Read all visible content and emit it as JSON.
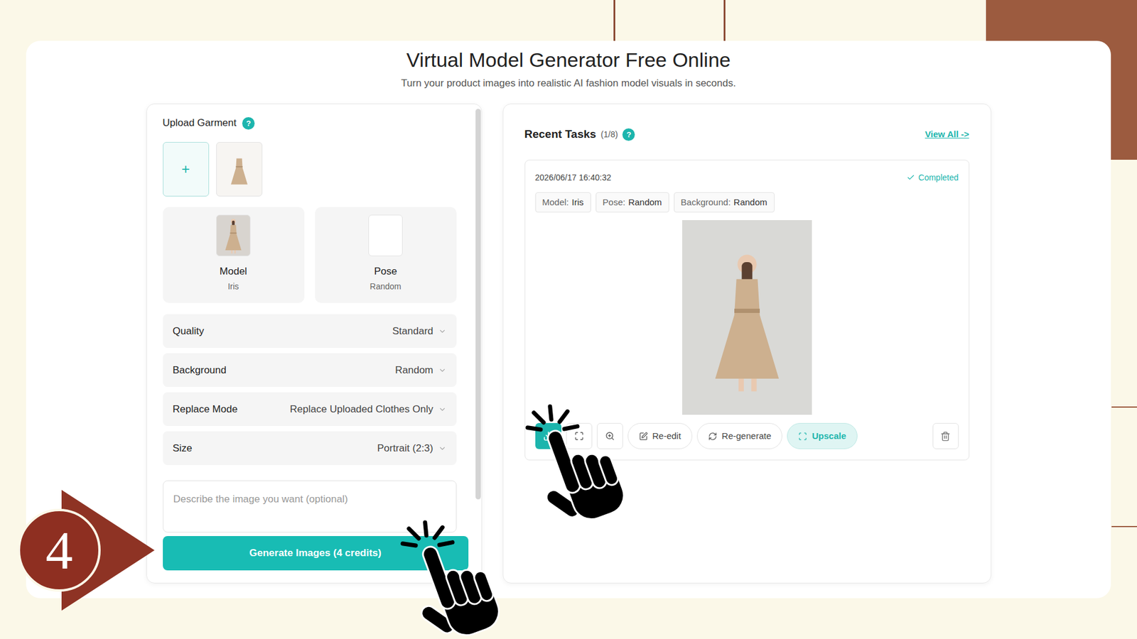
{
  "page": {
    "title": "Virtual Model Generator Free Online",
    "subtitle": "Turn your product images into realistic AI fashion model visuals in seconds."
  },
  "step": "4",
  "upload": {
    "label": "Upload Garment",
    "help": "?",
    "add": "+"
  },
  "picker_cards": [
    {
      "label": "Model",
      "value": "Iris"
    },
    {
      "label": "Pose",
      "value": "Random"
    }
  ],
  "settings": [
    {
      "label": "Quality",
      "value": "Standard"
    },
    {
      "label": "Background",
      "value": "Random"
    },
    {
      "label": "Replace Mode",
      "value": "Replace Uploaded Clothes Only"
    },
    {
      "label": "Size",
      "value": "Portrait (2:3)"
    }
  ],
  "prompt": {
    "placeholder": "Describe the image you want (optional)"
  },
  "generate_button": "Generate Images (4 credits)",
  "recent": {
    "title": "Recent Tasks",
    "count": "(1/8)",
    "help": "?",
    "view_all": "View All ->"
  },
  "task": {
    "date": "2026/06/17 16:40:32",
    "status": "Completed",
    "tags": [
      {
        "label": "Model:",
        "value": "Iris"
      },
      {
        "label": "Pose:",
        "value": "Random"
      },
      {
        "label": "Background:",
        "value": "Random"
      }
    ],
    "download_active": true,
    "text_actions": [
      {
        "label": "Re-edit",
        "highlighted": false
      },
      {
        "label": "Re-generate",
        "highlighted": false
      },
      {
        "label": "Upscale",
        "highlighted": true
      }
    ]
  }
}
